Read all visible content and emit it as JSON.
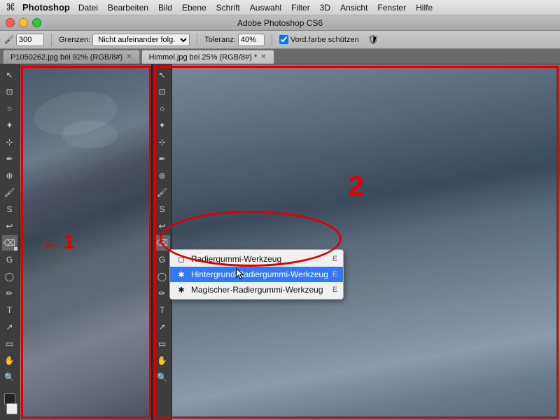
{
  "menubar": {
    "apple": "⌘",
    "app_name": "Photoshop",
    "items": [
      "Datei",
      "Bearbeiten",
      "Bild",
      "Ebene",
      "Schrift",
      "Auswahl",
      "Filter",
      "3D",
      "Ansicht",
      "Fenster",
      "Hilfe"
    ]
  },
  "titlebar": {
    "title": "Adobe Photoshop CS6"
  },
  "optionsbar": {
    "brush_size_label": "300",
    "grenzen_label": "Grenzen:",
    "grenzen_value": "Nicht aufeinander folg.",
    "toleranz_label": "Toleranz:",
    "toleranz_value": "40%",
    "vorderfarbe_label": "Vord.farbe schützen"
  },
  "tabs": [
    {
      "label": "P1050262.jpg bei 92% (RGB/8#)",
      "active": false
    },
    {
      "label": "Himmel.jpg bei 25% (RGB/8#) *",
      "active": true
    }
  ],
  "annotations": {
    "label1": "1",
    "label2": "2"
  },
  "context_menu": {
    "items": [
      {
        "label": "Radiergummi-Werkzeug",
        "shortcut": "E",
        "selected": false,
        "icon": "◻"
      },
      {
        "label": "Hintergrund-Radiergummi-Werkzeug",
        "shortcut": "E",
        "selected": true,
        "icon": "✱"
      },
      {
        "label": "Magischer-Radiergummi-Werkzeug",
        "shortcut": "E",
        "selected": false,
        "icon": "✱"
      }
    ]
  },
  "tools_left": [
    "M",
    "⊹",
    "○",
    "✂",
    "✒",
    "⌫",
    "S",
    "G",
    "⬛",
    "T",
    "A",
    "◇",
    "✋",
    "🔍"
  ],
  "tools_inner": [
    "↖",
    "⊹",
    "○",
    "✂",
    "⌫",
    "G",
    "⬛",
    "T",
    "↗"
  ]
}
